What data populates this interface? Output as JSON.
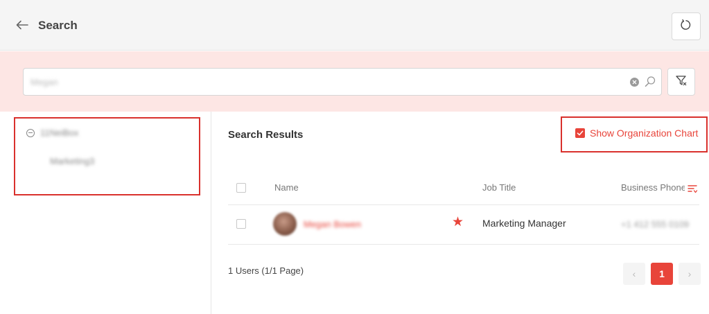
{
  "header": {
    "title": "Search",
    "back_icon": "arrow-left-icon",
    "refresh_icon": "refresh-icon"
  },
  "search": {
    "value": "Megan",
    "clear_icon": "clear-circle-icon",
    "search_icon": "magnifier-icon",
    "filter_icon": "filter-icon"
  },
  "tree": {
    "root_label": "11NeiBox",
    "child_label": "Marketing3"
  },
  "results": {
    "title": "Search Results",
    "org_chart_label": "Show Organization Chart",
    "org_chart_checked": true,
    "columns": {
      "name": "Name",
      "job_title": "Job Title",
      "business_phone": "Business Phone"
    },
    "rows": [
      {
        "name": "Megan Bowen",
        "job_title": "Marketing Manager",
        "phone": "+1 412 555 0109",
        "favorite": true
      }
    ],
    "count_text": "1 Users (1/1 Page)"
  },
  "pagination": {
    "prev": "‹",
    "current": "1",
    "next": "›"
  },
  "colors": {
    "accent": "#e8443a",
    "highlight_border": "#d9302c",
    "search_band": "#fde6e4",
    "header_bg": "#f5f5f5"
  }
}
